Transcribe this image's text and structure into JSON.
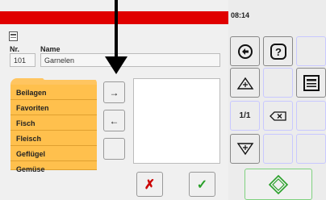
{
  "header": {
    "time": "08:14"
  },
  "record": {
    "nr_label": "Nr.",
    "name_label": "Name",
    "nr_value": "101",
    "name_value": "Garnelen"
  },
  "categories": [
    "Beilagen",
    "Favoriten",
    "Fisch",
    "Fleisch",
    "Geflügel",
    "Gemüse"
  ],
  "side_buttons": {
    "move_right": "→",
    "move_left": "←"
  },
  "actions": {
    "cancel": "✗",
    "confirm": "✓"
  },
  "keypad": {
    "page_indicator": "1/1"
  },
  "icons": {
    "back": "back-arrow-icon",
    "help": "help-icon",
    "menu": "menu-icon",
    "up": "up-triangle-icon",
    "down": "down-triangle-icon",
    "delete": "backspace-icon",
    "ok": "diamond-ok-icon"
  },
  "colors": {
    "header_red": "#e00000",
    "tab_orange": "#ffc04d",
    "cancel_red": "#cc0000",
    "confirm_green": "#2aa02a"
  }
}
